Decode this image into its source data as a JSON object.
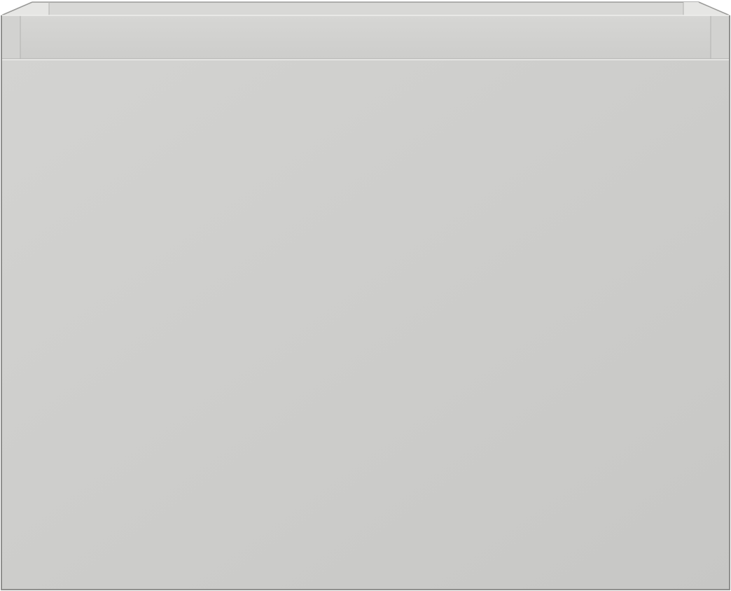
{
  "image": {
    "subject": "cabinet",
    "colors": {
      "background": "#ffffff",
      "front_panel_top": "#d3d3d1",
      "front_panel_bottom": "#c7c7c5",
      "top_rim": "#cfcfcd",
      "inner_back_wall": "#d8d8d6",
      "inner_side_wall": "#e4e4e2",
      "edge_highlight": "#ededeb",
      "outline": "#8f8f8d"
    }
  }
}
